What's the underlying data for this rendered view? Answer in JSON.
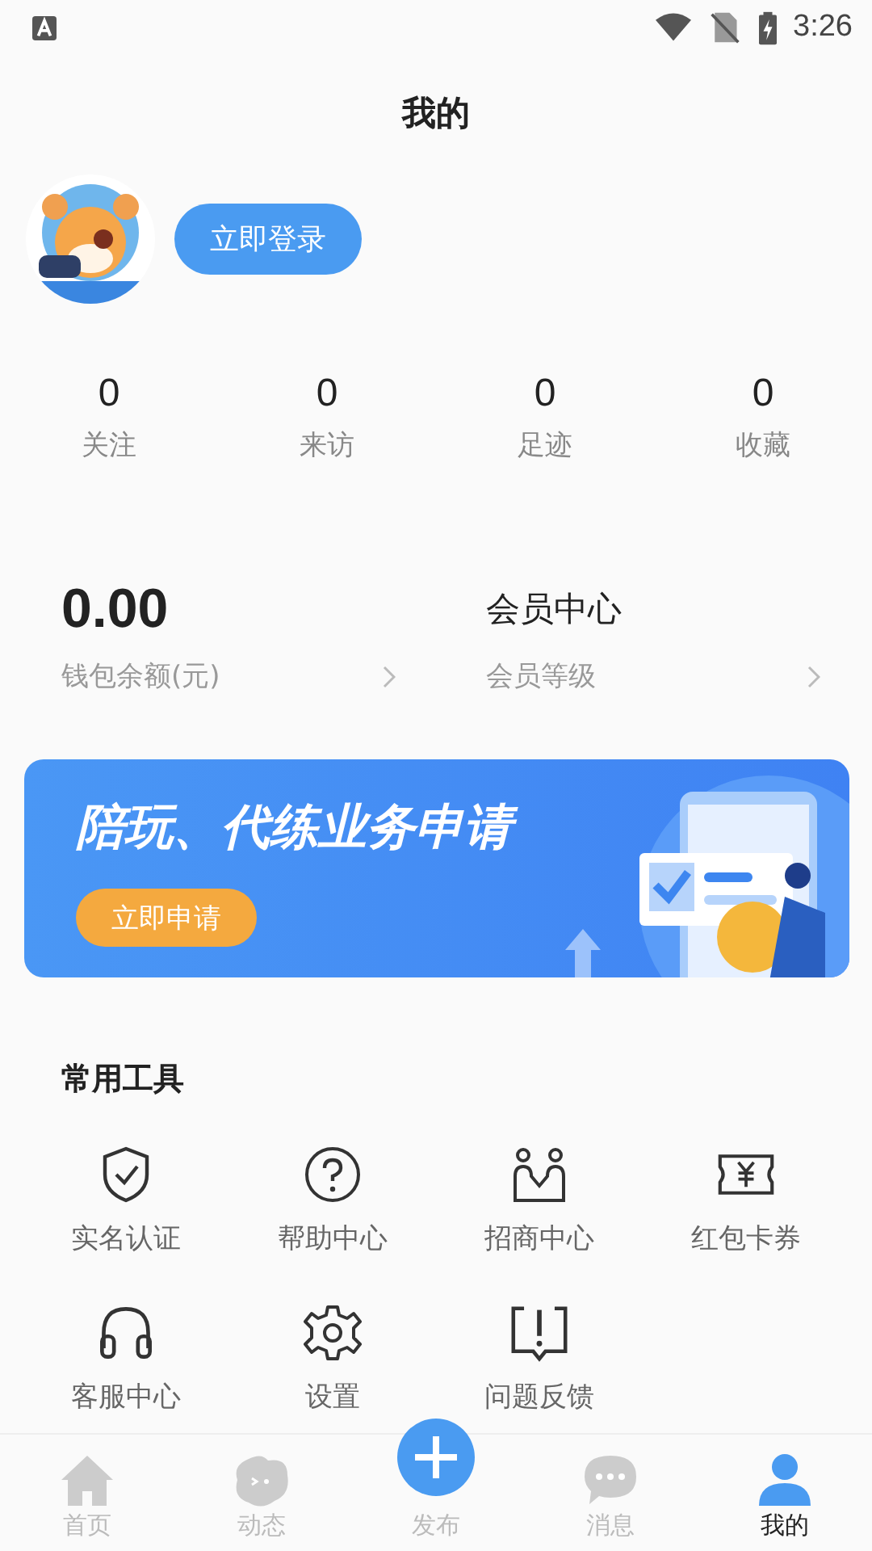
{
  "status_bar": {
    "time": "3:26"
  },
  "header": {
    "title": "我的"
  },
  "profile": {
    "login_button": "立即登录"
  },
  "stats": [
    {
      "value": "0",
      "label": "关注"
    },
    {
      "value": "0",
      "label": "来访"
    },
    {
      "value": "0",
      "label": "足迹"
    },
    {
      "value": "0",
      "label": "收藏"
    }
  ],
  "cards": [
    {
      "value": "0.00",
      "label": "钱包余额(元)",
      "kind": "number"
    },
    {
      "value": "会员中心",
      "label": "会员等级",
      "kind": "text"
    }
  ],
  "banner": {
    "title": "陪玩、代练业务申请",
    "button": "立即申请"
  },
  "tools": {
    "title": "常用工具",
    "items": [
      {
        "label": "实名认证",
        "kind": "shield"
      },
      {
        "label": "帮助中心",
        "kind": "help"
      },
      {
        "label": "招商中心",
        "kind": "people"
      },
      {
        "label": "红包卡券",
        "kind": "coupon"
      },
      {
        "label": "客服中心",
        "kind": "headset"
      },
      {
        "label": "设置",
        "kind": "gear"
      },
      {
        "label": "问题反馈",
        "kind": "feedback"
      }
    ]
  },
  "tab_bar": [
    {
      "label": "首页",
      "kind": "home",
      "selected": false
    },
    {
      "label": "动态",
      "kind": "moments",
      "selected": false
    },
    {
      "label": "发布",
      "kind": "publish",
      "selected": false
    },
    {
      "label": "消息",
      "kind": "message",
      "selected": false
    },
    {
      "label": "我的",
      "kind": "me",
      "selected": true
    }
  ]
}
